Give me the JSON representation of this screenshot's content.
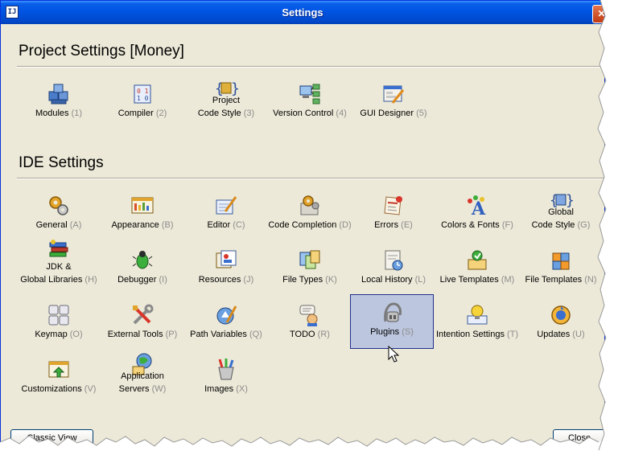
{
  "window": {
    "title": "Settings"
  },
  "project_section": {
    "title": "Project Settings [Money]",
    "items": [
      {
        "label": "Modules",
        "key": "(1)"
      },
      {
        "label": "Compiler",
        "key": "(2)"
      },
      {
        "line1": "Project",
        "label": "Code Style",
        "key": "(3)"
      },
      {
        "label": "Version Control",
        "key": "(4)"
      },
      {
        "label": "GUI Designer",
        "key": "(5)"
      }
    ]
  },
  "ide_section": {
    "title": "IDE Settings",
    "items": [
      {
        "label": "General",
        "key": "(A)"
      },
      {
        "label": "Appearance",
        "key": "(B)"
      },
      {
        "label": "Editor",
        "key": "(C)"
      },
      {
        "label": "Code Completion",
        "key": "(D)"
      },
      {
        "label": "Errors",
        "key": "(E)"
      },
      {
        "label": "Colors & Fonts",
        "key": "(F)"
      },
      {
        "line1": "Global",
        "label": "Code Style",
        "key": "(G)"
      },
      {
        "line1": "JDK &",
        "label": "Global Libraries",
        "key": "(H)"
      },
      {
        "label": "Debugger",
        "key": "(I)"
      },
      {
        "label": "Resources",
        "key": "(J)"
      },
      {
        "label": "File Types",
        "key": "(K)"
      },
      {
        "label": "Local History",
        "key": "(L)"
      },
      {
        "label": "Live Templates",
        "key": "(M)"
      },
      {
        "label": "File Templates",
        "key": "(N)"
      },
      {
        "label": "Keymap",
        "key": "(O)"
      },
      {
        "label": "External Tools",
        "key": "(P)"
      },
      {
        "label": "Path Variables",
        "key": "(Q)"
      },
      {
        "label": "TODO",
        "key": "(R)"
      },
      {
        "label": "Plugins",
        "key": "(S)",
        "selected": true
      },
      {
        "label": "Intention Settings",
        "key": "(T)"
      },
      {
        "label": "Updates",
        "key": "(U)"
      },
      {
        "label": "Customizations",
        "key": "(V)"
      },
      {
        "line1": "Application",
        "label": "Servers",
        "key": "(W)"
      },
      {
        "label": "Images",
        "key": "(X)"
      }
    ]
  },
  "buttons": {
    "classic_view": "Classic View",
    "close": "Close"
  },
  "colors": {
    "titlebar": "#0054e3",
    "face": "#ece9d8",
    "selection": "#bcc6de",
    "shortcut": "#8c8c8c"
  }
}
